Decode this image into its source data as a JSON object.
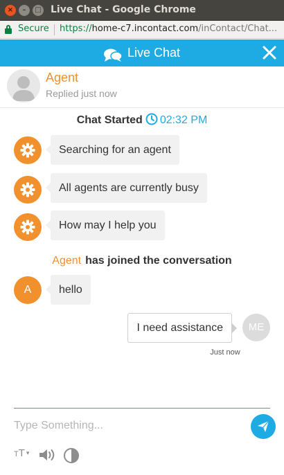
{
  "window": {
    "title": "Live Chat - Google Chrome"
  },
  "addressbar": {
    "secure_label": "Secure",
    "url_scheme": "https://",
    "url_host": "home-c7.incontact.com",
    "url_path": "/inContact/Chat..."
  },
  "header": {
    "title": "Live Chat",
    "chat_icon": "chat-bubbles-icon",
    "close_icon": "close-icon",
    "color": "#1eabe3"
  },
  "agent": {
    "name": "Agent",
    "status": "Replied just now",
    "accent": "#f0912e"
  },
  "chat_started": {
    "label": "Chat Started",
    "time": "02:32 PM"
  },
  "messages": [
    {
      "from": "system",
      "icon": "gear-icon",
      "text": "Searching for an agent"
    },
    {
      "from": "system",
      "icon": "gear-icon",
      "text": "All agents are currently busy"
    },
    {
      "from": "system",
      "icon": "gear-icon",
      "text": "How may I help you"
    }
  ],
  "joined": {
    "who": "Agent",
    "what": "has joined the conversation"
  },
  "agent_message": {
    "avatar_letter": "A",
    "text": "hello"
  },
  "user_message": {
    "text": "I need assistance",
    "avatar": "ME",
    "time": "Just now"
  },
  "composer": {
    "placeholder": "Type Something...",
    "send_icon": "send-icon"
  },
  "tools": {
    "font_size_small": "T",
    "font_size_big": "T",
    "font_size_caret": "▾",
    "volume_icon": "volume-icon",
    "contrast_icon": "contrast-icon"
  }
}
